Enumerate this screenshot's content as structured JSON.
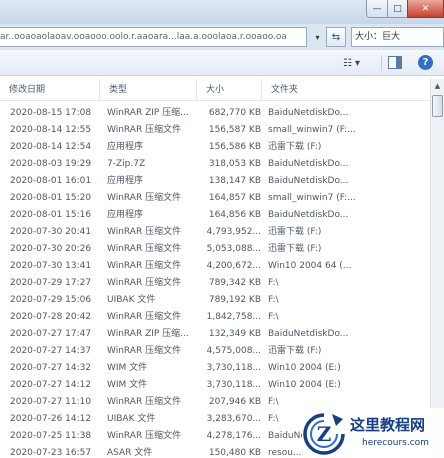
{
  "window": {
    "minimize_glyph": "—",
    "maximize_glyph": "□",
    "close_glyph": "✕"
  },
  "address_bar": {
    "path_fragment": "ar..ooaoaolaoav.ooaooo.oolo.r.aaoara...laa.a.ooolaoa.r.ooaoo.oa"
  },
  "search": {
    "value": "大小：巨大",
    "icon": "search-icon"
  },
  "columns": {
    "date": "修改日期",
    "type": "类型",
    "size": "大小",
    "folder": "文件夹"
  },
  "files": [
    {
      "date": "2020-08-15 17:08",
      "type": "WinRAR ZIP 压缩...",
      "size": "682,770 KB",
      "folder": "BaiduNetdiskDo..."
    },
    {
      "date": "2020-08-14 12:55",
      "type": "WinRAR 压缩文件",
      "size": "156,587 KB",
      "folder": "small_winwin7 (F:..."
    },
    {
      "date": "2020-08-14 12:54",
      "type": "应用程序",
      "size": "156,586 KB",
      "folder": "迅雷下载 (F:)"
    },
    {
      "date": "2020-08-03 19:29",
      "type": "7-Zip.7Z",
      "size": "318,053 KB",
      "folder": "BaiduNetdiskDo..."
    },
    {
      "date": "2020-08-01 16:01",
      "type": "应用程序",
      "size": "138,147 KB",
      "folder": "BaiduNetdiskDo..."
    },
    {
      "date": "2020-08-01 15:20",
      "type": "WinRAR 压缩文件",
      "size": "164,857 KB",
      "folder": "small_winwin7 (F:..."
    },
    {
      "date": "2020-08-01 15:16",
      "type": "应用程序",
      "size": "164,856 KB",
      "folder": "BaiduNetdiskDo..."
    },
    {
      "date": "2020-07-30 20:41",
      "type": "WinRAR 压缩文件",
      "size": "4,793,952...",
      "folder": "迅雷下载 (F:)"
    },
    {
      "date": "2020-07-30 20:26",
      "type": "WinRAR 压缩文件",
      "size": "5,053,088...",
      "folder": "迅雷下载 (F:)"
    },
    {
      "date": "2020-07-30 13:41",
      "type": "WinRAR 压缩文件",
      "size": "4,200,672...",
      "folder": "Win10 2004 64 (..."
    },
    {
      "date": "2020-07-29 17:27",
      "type": "WinRAR 压缩文件",
      "size": "789,342 KB",
      "folder": "F:\\"
    },
    {
      "date": "2020-07-29 15:06",
      "type": "UIBAK 文件",
      "size": "789,192 KB",
      "folder": "F:\\"
    },
    {
      "date": "2020-07-28 20:42",
      "type": "WinRAR 压缩文件",
      "size": "1,842,758...",
      "folder": "F:\\"
    },
    {
      "date": "2020-07-27 17:47",
      "type": "WinRAR ZIP 压缩...",
      "size": "132,349 KB",
      "folder": "BaiduNetdiskDo..."
    },
    {
      "date": "2020-07-27 14:37",
      "type": "WinRAR 压缩文件",
      "size": "4,575,008...",
      "folder": "迅雷下载 (F:)"
    },
    {
      "date": "2020-07-27 14:32",
      "type": "WIM 文件",
      "size": "3,730,118...",
      "folder": "Win10 2004 (E:)"
    },
    {
      "date": "2020-07-27 14:12",
      "type": "WIM 文件",
      "size": "3,730,118...",
      "folder": "Win10 2004 (E:)"
    },
    {
      "date": "2020-07-27 11:10",
      "type": "WinRAR 压缩文件",
      "size": "207,946 KB",
      "folder": "F:\\"
    },
    {
      "date": "2020-07-26 14:12",
      "type": "UIBAK 文件",
      "size": "3,283,670...",
      "folder": "F:\\"
    },
    {
      "date": "2020-07-25 11:38",
      "type": "WinRAR 压缩文件",
      "size": "4,278,176...",
      "folder": "BaiduNetdiskDo..."
    },
    {
      "date": "2020-07-23 16:57",
      "type": "ASAR 文件",
      "size": "150,480 KB",
      "folder": "resou..."
    }
  ],
  "watermark": {
    "title": "这里教程网",
    "url": "herecours.com",
    "logo_letter": "Z"
  },
  "colors": {
    "text": "#505866",
    "header_text": "#4a5a70",
    "toolbar_bg": "#e3ebf5",
    "close_button": "#c7402d",
    "watermark_blue": "#163f86"
  }
}
